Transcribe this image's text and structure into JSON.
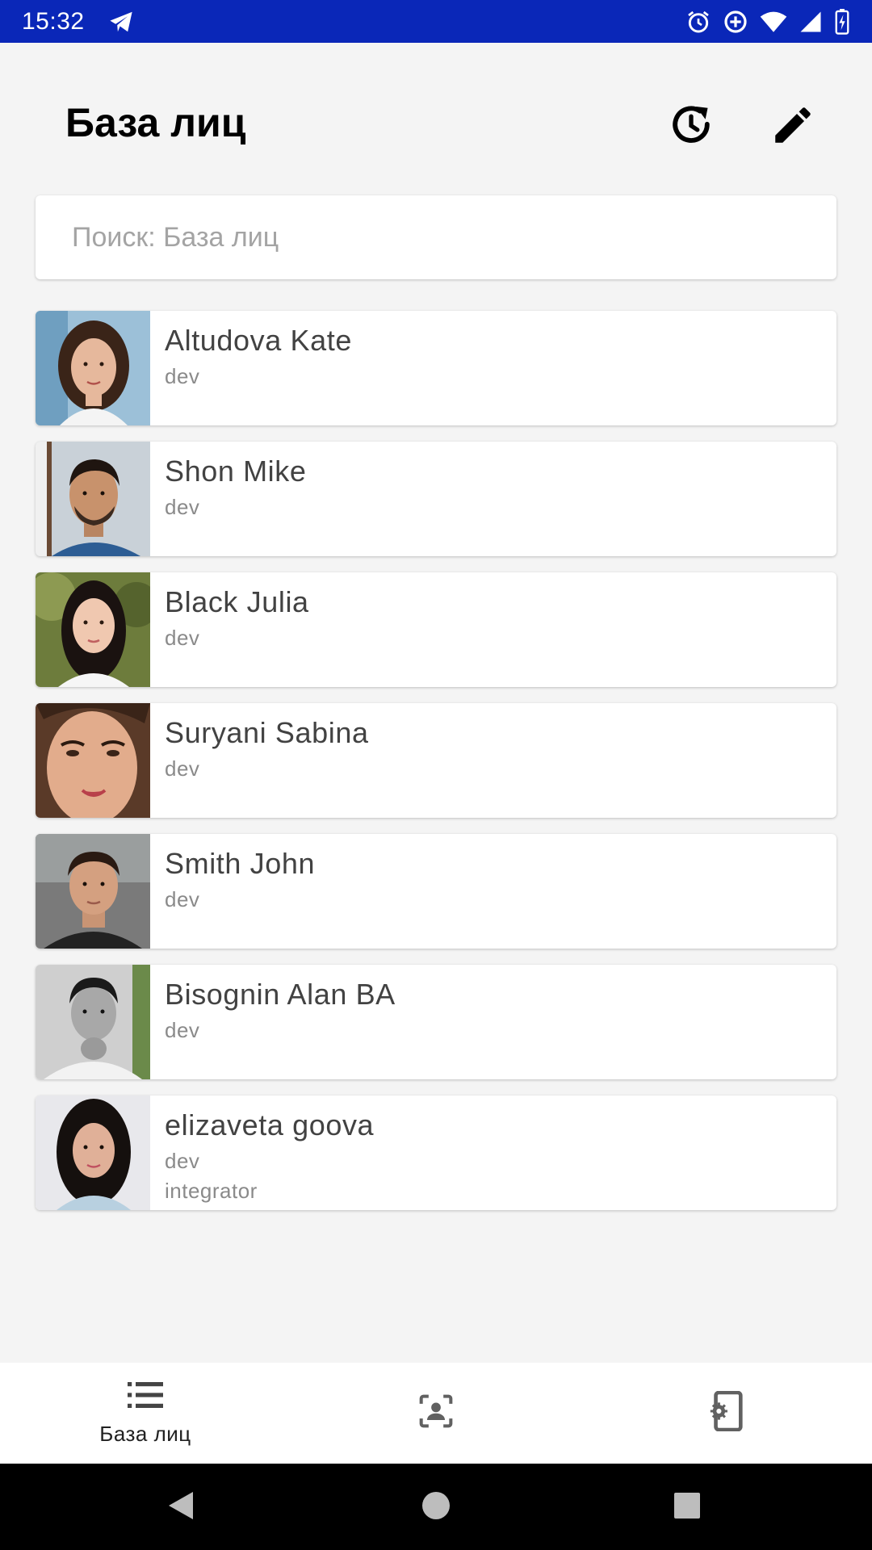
{
  "status_bar": {
    "time": "15:32",
    "left_icons": [
      "telegram-icon"
    ],
    "right_icons": [
      "alarm-icon",
      "data-saver-icon",
      "wifi-icon",
      "signal-icon",
      "battery-charging-icon"
    ]
  },
  "header": {
    "title": "База лиц",
    "actions": [
      "history-icon",
      "edit-icon"
    ]
  },
  "search": {
    "placeholder": "Поиск: База лиц",
    "value": ""
  },
  "faces": [
    {
      "name": "Altudova Kate",
      "tags": [
        "dev"
      ]
    },
    {
      "name": "Shon Mike",
      "tags": [
        "dev"
      ]
    },
    {
      "name": "Black Julia",
      "tags": [
        "dev"
      ]
    },
    {
      "name": "Suryani Sabina",
      "tags": [
        "dev"
      ]
    },
    {
      "name": "Smith John",
      "tags": [
        "dev"
      ]
    },
    {
      "name": "Bisognin Alan BA",
      "tags": [
        "dev"
      ]
    },
    {
      "name": "elizaveta goova",
      "tags": [
        "dev",
        "integrator"
      ]
    }
  ],
  "bottom_nav": {
    "items": [
      {
        "label": "База лиц",
        "icon": "list-icon",
        "active": true
      },
      {
        "label": "",
        "icon": "face-recognition-icon",
        "active": false
      },
      {
        "label": "",
        "icon": "device-settings-icon",
        "active": false
      }
    ]
  },
  "colors": {
    "status_bar": "#0a27b8",
    "background": "#f4f4f4",
    "card": "#ffffff",
    "icon_inactive": "#616161"
  }
}
